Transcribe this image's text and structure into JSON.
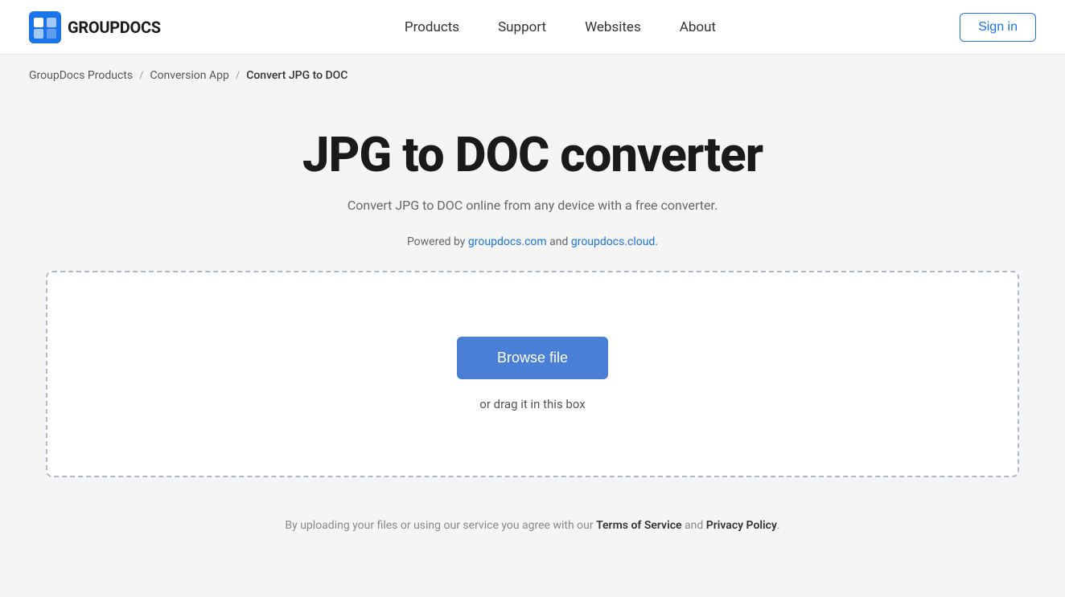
{
  "logo": {
    "text": "GROUPDOCS"
  },
  "nav": {
    "items": [
      {
        "label": "Products",
        "href": "#"
      },
      {
        "label": "Support",
        "href": "#"
      },
      {
        "label": "Websites",
        "href": "#"
      },
      {
        "label": "About",
        "href": "#"
      }
    ],
    "sign_in_label": "Sign in"
  },
  "breadcrumb": {
    "items": [
      {
        "label": "GroupDocs Products",
        "href": "#"
      },
      {
        "label": "Conversion App",
        "href": "#"
      },
      {
        "label": "Convert JPG to DOC"
      }
    ],
    "separator": "/"
  },
  "main": {
    "title": "JPG to DOC converter",
    "subtitle": "Convert JPG to DOC online from any device with a free converter.",
    "powered_by_prefix": "Powered by ",
    "powered_by_link1_text": "groupdocs.com",
    "powered_by_link1_href": "https://groupdocs.com",
    "powered_by_and": " and ",
    "powered_by_link2_text": "groupdocs.cloud",
    "powered_by_link2_href": "https://groupdocs.cloud",
    "powered_by_suffix": ".",
    "browse_file_label": "Browse file",
    "drag_text": "or drag it in this box"
  },
  "footer_note": {
    "prefix": "By uploading your files or using our service you agree with our ",
    "tos_label": "Terms of Service",
    "and": " and ",
    "privacy_label": "Privacy Policy",
    "suffix": "."
  }
}
